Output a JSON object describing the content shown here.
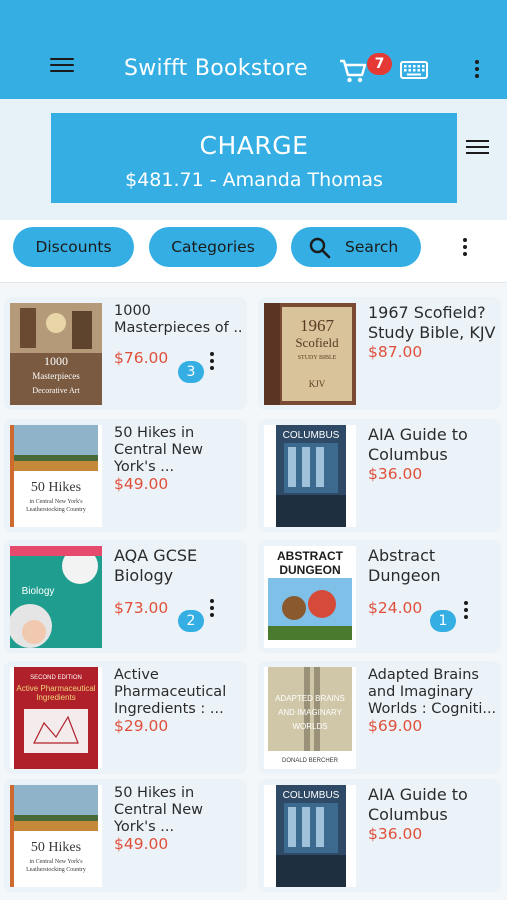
{
  "app": {
    "title": "Swifft Bookstore",
    "cart_count": "7",
    "accent": "#35aee3",
    "price_color": "#e0503a",
    "badge_color": "#e53935"
  },
  "charge": {
    "label": "CHARGE",
    "detail": "$481.71 - Amanda Thomas"
  },
  "filters": {
    "discounts": "Discounts",
    "categories": "Categories",
    "search": "Search"
  },
  "products": [
    {
      "lines": [
        "1000",
        "Masterpieces of ..."
      ],
      "price": "$76.00",
      "qty": "3",
      "cover_text": [
        "1000",
        "Masterpieces",
        "Decorative Art"
      ]
    },
    {
      "lines": [
        "1967 Scofield?",
        "Study Bible, KJV"
      ],
      "price": "$87.00",
      "cover_text": [
        "1967",
        "Scofield",
        "STUDY BIBLE",
        "KJV"
      ]
    },
    {
      "lines": [
        "50 Hikes in",
        "Central New",
        "York's ..."
      ],
      "price": "$49.00",
      "cover_text": [
        "50 Hikes",
        "in Central New York's",
        "Leatherstocking Country"
      ]
    },
    {
      "lines": [
        "AIA Guide to",
        "Columbus"
      ],
      "price": "$36.00",
      "cover_text": [
        "COLUMBUS"
      ]
    },
    {
      "lines": [
        "AQA GCSE",
        "Biology"
      ],
      "price": "$73.00",
      "qty": "2",
      "cover_text": [
        "Biology"
      ]
    },
    {
      "lines": [
        "Abstract",
        "Dungeon"
      ],
      "price": "$24.00",
      "qty": "1",
      "cover_text": [
        "ABSTRACT",
        "DUNGEON"
      ]
    },
    {
      "lines": [
        "Active",
        "Pharmaceutical",
        "Ingredients : ..."
      ],
      "price": "$29.00",
      "cover_text": [
        "SECOND EDITION",
        "Active Pharmaceutical",
        "Ingredients"
      ]
    },
    {
      "lines": [
        "Adapted Brains",
        "and Imaginary",
        "Worlds : Cogniti..."
      ],
      "price": "$69.00",
      "cover_text": [
        "ADAPTED BRAINS",
        "AND IMAGINARY",
        "WORLDS",
        "DONALD BERCHER"
      ]
    },
    {
      "lines": [
        "50 Hikes in",
        "Central New",
        "York's ..."
      ],
      "price": "$49.00",
      "cover_text": [
        "50 Hikes",
        "in Central New York's",
        "Leatherstocking Country"
      ]
    },
    {
      "lines": [
        "AIA Guide to",
        "Columbus"
      ],
      "price": "$36.00",
      "cover_text": [
        "COLUMBUS"
      ]
    }
  ]
}
